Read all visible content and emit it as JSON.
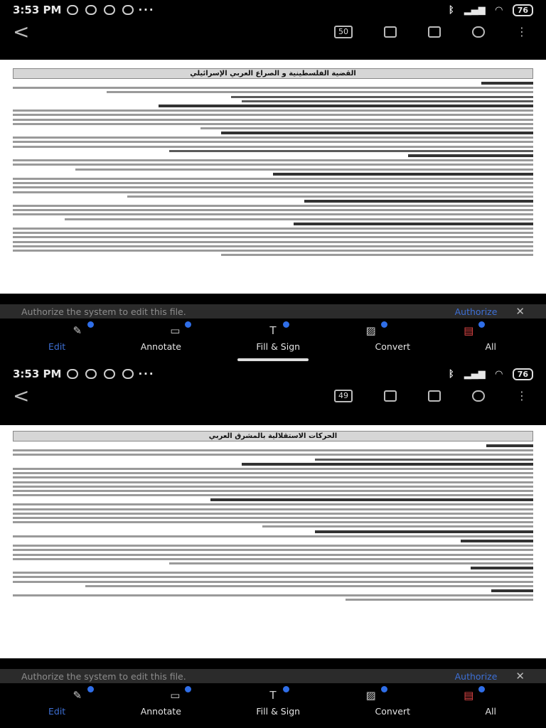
{
  "screens": [
    {
      "status": {
        "time": "3:53 PM",
        "dots": "···",
        "battery": "76"
      },
      "toolbar": {
        "page_number": "50"
      },
      "document": {
        "title": "القضية الفلسطينية و الصراع العربي الإسرائيلي"
      },
      "authorize_bar": {
        "message": "Authorize the system to edit this file.",
        "action": "Authorize",
        "close": "✕"
      },
      "tabs": [
        "Edit",
        "Annotate",
        "Fill & Sign",
        "Convert",
        "All"
      ],
      "active_tab": "Edit"
    },
    {
      "status": {
        "time": "3:53 PM",
        "dots": "···",
        "battery": "76"
      },
      "toolbar": {
        "page_number": "49"
      },
      "document": {
        "title": "الحركات الاستقلالية بالمشرق العربي"
      },
      "authorize_bar": {
        "message": "Authorize the system to edit this file.",
        "action": "Authorize",
        "close": "✕"
      },
      "tabs": [
        "Edit",
        "Annotate",
        "Fill & Sign",
        "Convert",
        "All"
      ],
      "active_tab": "Edit"
    }
  ],
  "icons": {
    "back": "back-arrow-icon",
    "tools": [
      "edit-text-icon",
      "annotate-icon",
      "text-cursor-icon",
      "edit-image-icon",
      "pdf-convert-icon"
    ]
  },
  "colors": {
    "accent": "#3d6fd4",
    "dot": "#2f6ee8",
    "bar": "#2b2b2b"
  }
}
